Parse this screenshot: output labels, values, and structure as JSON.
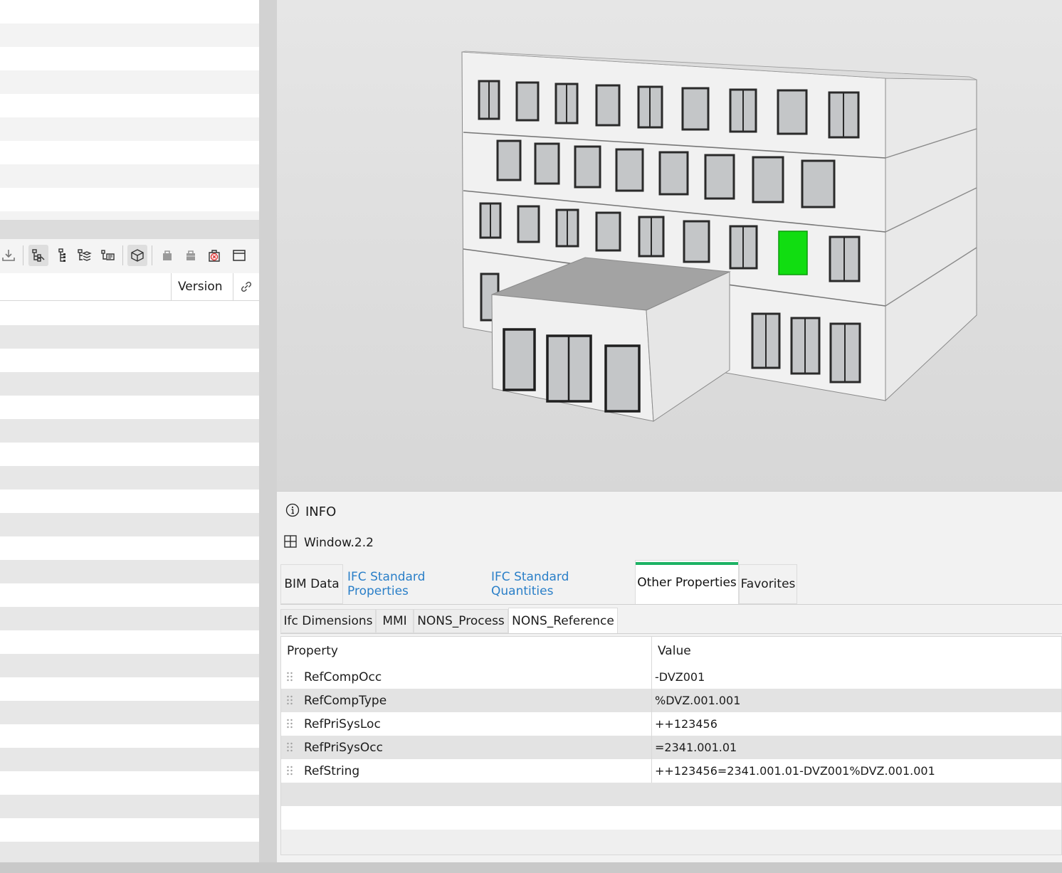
{
  "tree_panel": {
    "columns": {
      "version": "Version"
    },
    "toolbar_icons": [
      "download-icon",
      "hierarchy-tree-icon",
      "structure-tree-icon",
      "layers-tree-icon",
      "type-tree-icon",
      "3d-box-icon",
      "storey-filled-icon",
      "storey-icon",
      "clear-selection-icon",
      "window-layout-icon"
    ]
  },
  "info": {
    "header": "INFO",
    "element_name": "Window.2.2",
    "main_tabs": [
      {
        "label": "BIM Data",
        "state": "normal"
      },
      {
        "label": "IFC Standard Properties",
        "state": "link"
      },
      {
        "label": "IFC Standard Quantities",
        "state": "link"
      },
      {
        "label": "Other Properties",
        "state": "active"
      },
      {
        "label": "Favorites",
        "state": "normal"
      }
    ],
    "sub_tabs": [
      {
        "label": "Ifc Dimensions",
        "active": false
      },
      {
        "label": "MMI",
        "active": false
      },
      {
        "label": "NONS_Process",
        "active": false
      },
      {
        "label": "NONS_Reference",
        "active": true
      }
    ],
    "table": {
      "headers": {
        "property": "Property",
        "value": "Value"
      },
      "rows": [
        {
          "property": "RefCompOcc",
          "value": "-DVZ001"
        },
        {
          "property": "RefCompType",
          "value": "%DVZ.001.001"
        },
        {
          "property": "RefPriSysLoc",
          "value": "++123456"
        },
        {
          "property": "RefPriSysOcc",
          "value": "=2341.001.01"
        },
        {
          "property": "RefString",
          "value": "++123456=2341.001.01-DVZ001%DVZ.001.001"
        }
      ]
    }
  },
  "viewer": {
    "selected_element": "Window.2.2",
    "highlight_color": "#11dd11"
  }
}
